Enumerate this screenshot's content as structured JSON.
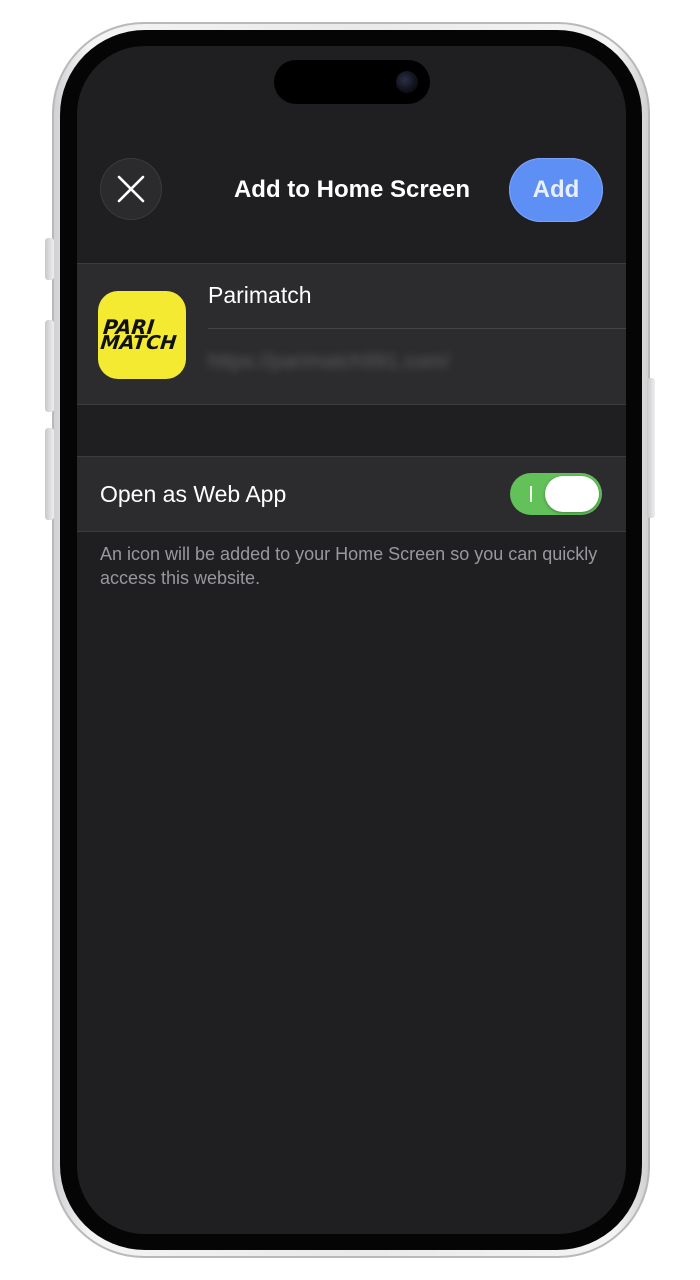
{
  "sheet": {
    "title": "Add to Home Screen",
    "close_icon": "close-icon",
    "add_label": "Add",
    "add_color": "#5d8ff5"
  },
  "app": {
    "name": "Parimatch",
    "url": "https://parimatch991.com/",
    "icon_line1": "PARI",
    "icon_line2": "MATCH",
    "icon_color": "#f4ea32"
  },
  "web_app": {
    "label": "Open as Web App",
    "toggle_state": "on",
    "toggle_color": "#63c15a",
    "footnote": "An icon will be added to your Home Screen so you can quickly access this website."
  }
}
